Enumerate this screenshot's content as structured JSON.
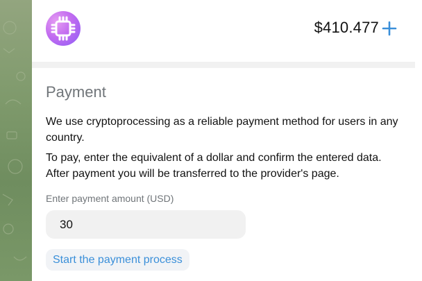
{
  "header": {
    "logo_icon": "chip-logo-icon",
    "balance": "$410.477",
    "add_icon": "plus-icon",
    "accent_color": "#3a8fd9"
  },
  "payment": {
    "title": "Payment",
    "paragraph_1": "We use cryptoprocessing as a reliable payment method for users in any country.",
    "paragraph_2": "To pay, enter the equivalent of a dollar and confirm the entered data. After payment you will be transferred to the provider's page.",
    "amount_label": "Enter payment amount (USD)",
    "amount_value": "30",
    "start_button_label": "Start the payment process"
  }
}
